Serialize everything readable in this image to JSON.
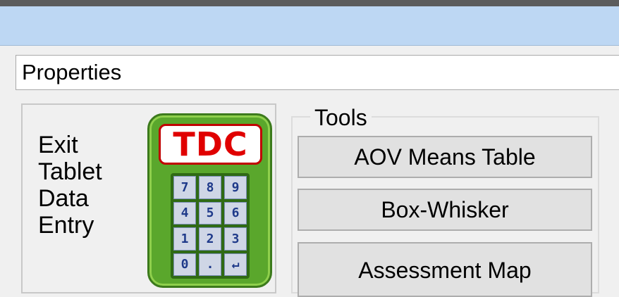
{
  "properties_label": "Properties",
  "launcher": {
    "lines": [
      "Exit",
      "Tablet",
      "Data",
      "Entry"
    ],
    "logo_text": "TDC",
    "keys": [
      "7",
      "8",
      "9",
      "4",
      "5",
      "6",
      "1",
      "2",
      "3",
      "0",
      ".",
      "↵"
    ]
  },
  "tools": {
    "legend": "Tools",
    "buttons": [
      "AOV Means Table",
      "Box-Whisker",
      "Assessment Map"
    ]
  },
  "colors": {
    "titlebar": "#bdd7f3",
    "device_green": "#5aa72c",
    "logo_red": "#e00000"
  }
}
